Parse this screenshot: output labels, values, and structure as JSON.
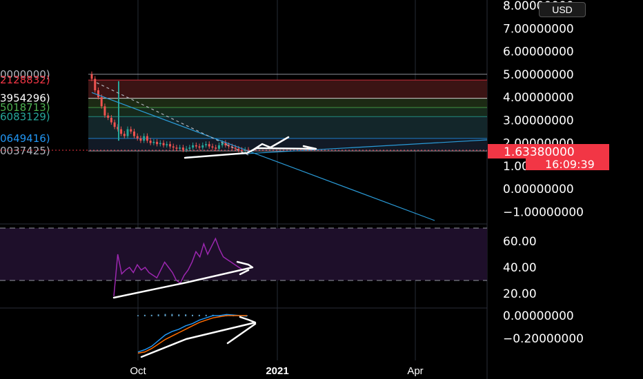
{
  "currency_button": "USD",
  "colors": {
    "background": "#000000",
    "price_axis_text": "#ffffff",
    "trendline": "#2a9bd8",
    "rsi_line": "#9c27b0",
    "rsi_band": "#1e0f2a",
    "candle_up": "#26a69a",
    "candle_down": "#ef5350",
    "price_label_bg": "#f23645",
    "macd_line": "#2196f3",
    "signal_line": "#ff6d00",
    "annotation": "#ffffff"
  },
  "chart_data": {
    "type": "candlestick",
    "price_axis": {
      "ticks": [
        "8.00000000",
        "7.00000000",
        "6.00000000",
        "5.00000000",
        "4.00000000",
        "3.00000000",
        "2.00000000",
        "1.00000000",
        "0.00000000",
        "−1.00000000"
      ],
      "values": [
        8,
        7,
        6,
        5,
        4,
        3,
        2,
        1,
        0,
        -1
      ]
    },
    "time_axis": {
      "ticks": [
        "Oct",
        "2021",
        "Apr"
      ],
      "bold": [
        false,
        true,
        false
      ]
    },
    "current_price_label": "1.63380000",
    "countdown_label": "16:09:39",
    "fib_levels": [
      {
        "label": "0000000)",
        "color": "#b2b5be",
        "price": 5.0
      },
      {
        "label": "2128832)",
        "color": "#f23645",
        "price": 4.75
      },
      {
        "label": "3954296)",
        "color": "#ffffff",
        "price": 3.95
      },
      {
        "label": "5018713)",
        "color": "#4caf50",
        "price": 3.55
      },
      {
        "label": "6083129)",
        "color": "#26a69a",
        "price": 3.15
      },
      {
        "label": "0649416)",
        "color": "#2196f3",
        "price": 2.2
      },
      {
        "label": "0037425)",
        "color": "#b2b5be",
        "price": 1.65
      }
    ],
    "fib_zones": [
      {
        "from": 4.75,
        "to": 3.95,
        "color": "#3b1414"
      },
      {
        "from": 3.95,
        "to": 3.55,
        "color": "#1c2a14"
      },
      {
        "from": 3.55,
        "to": 3.15,
        "color": "#162a1c"
      },
      {
        "from": 3.15,
        "to": 2.2,
        "color": "#13262a"
      },
      {
        "from": 2.2,
        "to": 1.65,
        "color": "#121a26"
      }
    ],
    "price_series": [
      4.8,
      4.3,
      4.0,
      3.6,
      3.2,
      3.1,
      2.9,
      2.7,
      2.6,
      2.4,
      2.3,
      2.6,
      2.5,
      2.3,
      2.2,
      2.1,
      2.3,
      2.1,
      2.0,
      2.05,
      1.95,
      2.0,
      1.9,
      1.95,
      1.85,
      1.8,
      1.75,
      1.8,
      1.7,
      1.75,
      1.8,
      1.9,
      1.85,
      1.8,
      1.9,
      1.95,
      1.85,
      1.8,
      1.75,
      1.9,
      2.0,
      1.9,
      1.85,
      1.8,
      1.75,
      1.7,
      1.65,
      1.7,
      1.63
    ],
    "rsi": {
      "ticks": [
        "60.00",
        "40.00",
        "20.00"
      ],
      "values": [
        60,
        40,
        20
      ],
      "upper": 70,
      "lower": 30,
      "series": [
        18,
        50,
        35,
        38,
        40,
        36,
        42,
        38,
        40,
        36,
        34,
        32,
        38,
        44,
        40,
        36,
        30,
        28,
        34,
        38,
        44,
        52,
        48,
        58,
        50,
        56,
        62,
        54,
        48,
        46,
        44,
        42,
        40,
        38
      ]
    },
    "macd": {
      "ticks": [
        "0.00000000",
        "−0.20000000"
      ],
      "values": [
        0,
        -0.2
      ],
      "macd_series": [
        -0.32,
        -0.3,
        -0.27,
        -0.22,
        -0.17,
        -0.14,
        -0.12,
        -0.09,
        -0.07,
        -0.04,
        -0.02,
        0.0,
        0.0,
        0.01,
        0.005,
        0.0,
        -0.005
      ],
      "signal_series": [
        -0.33,
        -0.32,
        -0.29,
        -0.25,
        -0.21,
        -0.18,
        -0.15,
        -0.12,
        -0.09,
        -0.06,
        -0.04,
        -0.02,
        -0.01,
        0.0,
        0.0,
        0.0,
        0.0
      ]
    }
  }
}
